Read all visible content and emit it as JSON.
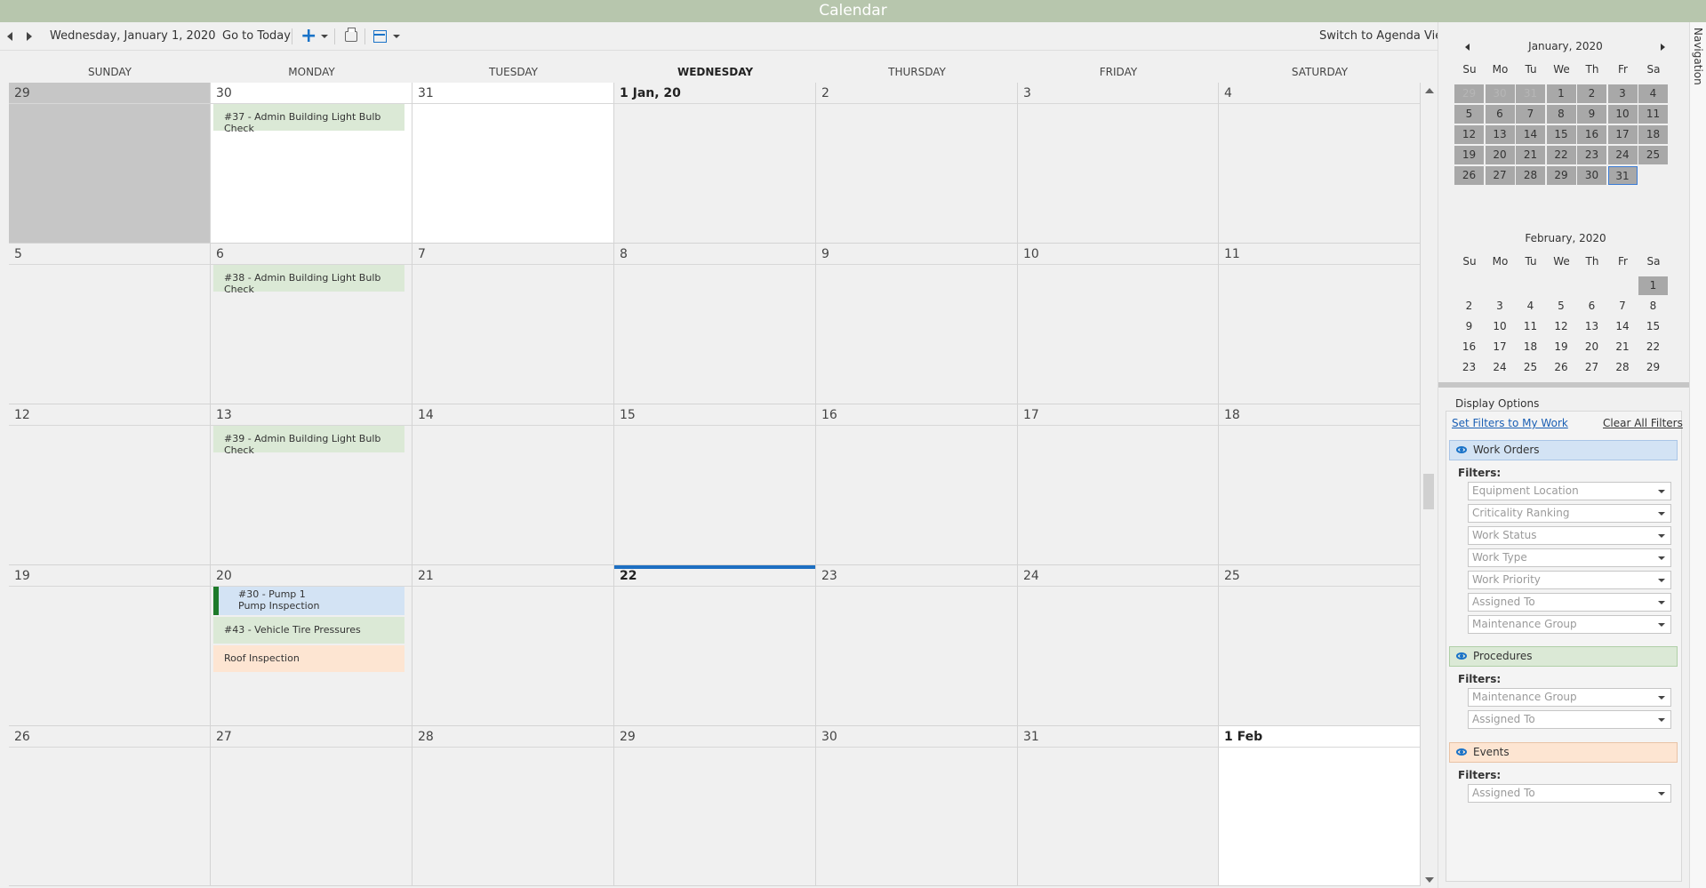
{
  "window": {
    "title": "Calendar"
  },
  "toolbar": {
    "current_date": "Wednesday, January 1, 2020",
    "go_to_today": "Go to Today",
    "switch_view": "Switch to Agenda View"
  },
  "calendar": {
    "day_headers": [
      "SUNDAY",
      "MONDAY",
      "TUESDAY",
      "WEDNESDAY",
      "THURSDAY",
      "FRIDAY",
      "SATURDAY"
    ],
    "today_header_index": 3,
    "weeks": [
      [
        {
          "label": "29",
          "style": "grey"
        },
        {
          "label": "30",
          "style": "white",
          "events": [
            {
              "type": "wo",
              "text": "#37 - Admin Building Light Bulb Check"
            }
          ]
        },
        {
          "label": "31",
          "style": "white"
        },
        {
          "label": "1 Jan, 20",
          "bold": true
        },
        {
          "label": "2"
        },
        {
          "label": "3"
        },
        {
          "label": "4"
        }
      ],
      [
        {
          "label": "5"
        },
        {
          "label": "6",
          "events": [
            {
              "type": "wo",
              "text": "#38 - Admin Building Light Bulb Check"
            }
          ]
        },
        {
          "label": "7"
        },
        {
          "label": "8"
        },
        {
          "label": "9"
        },
        {
          "label": "10"
        },
        {
          "label": "11"
        }
      ],
      [
        {
          "label": "12"
        },
        {
          "label": "13",
          "events": [
            {
              "type": "wo",
              "text": "#39 - Admin Building Light Bulb Check"
            }
          ]
        },
        {
          "label": "14"
        },
        {
          "label": "15"
        },
        {
          "label": "16"
        },
        {
          "label": "17"
        },
        {
          "label": "18"
        }
      ],
      [
        {
          "label": "19"
        },
        {
          "label": "20",
          "events": [
            {
              "type": "wo-blue",
              "text": "#30 - Pump 1",
              "text2": "Pump Inspection"
            },
            {
              "type": "wo",
              "text": "#43 - Vehicle Tire Pressures"
            },
            {
              "type": "ev",
              "text": "Roof Inspection"
            }
          ]
        },
        {
          "label": "21"
        },
        {
          "label": "22",
          "bold": true,
          "today": true
        },
        {
          "label": "23"
        },
        {
          "label": "24"
        },
        {
          "label": "25"
        }
      ],
      [
        {
          "label": "26"
        },
        {
          "label": "27"
        },
        {
          "label": "28"
        },
        {
          "label": "29"
        },
        {
          "label": "30"
        },
        {
          "label": "31"
        },
        {
          "label": "1 Feb",
          "bold": true,
          "style": "white"
        }
      ]
    ]
  },
  "mini_calendars": [
    {
      "title": "January, 2020",
      "dow": [
        "Su",
        "Mo",
        "Tu",
        "We",
        "Th",
        "Fr",
        "Sa"
      ],
      "weeks": [
        [
          {
            "d": "29",
            "dim": true,
            "hl": true
          },
          {
            "d": "30",
            "dim": true,
            "hl": true
          },
          {
            "d": "31",
            "dim": true,
            "hl": true
          },
          {
            "d": "1",
            "hl": true
          },
          {
            "d": "2",
            "hl": true
          },
          {
            "d": "3",
            "hl": true
          },
          {
            "d": "4",
            "hl": true
          }
        ],
        [
          {
            "d": "5",
            "hl": true
          },
          {
            "d": "6",
            "hl": true
          },
          {
            "d": "7",
            "hl": true
          },
          {
            "d": "8",
            "hl": true
          },
          {
            "d": "9",
            "hl": true
          },
          {
            "d": "10",
            "hl": true
          },
          {
            "d": "11",
            "hl": true
          }
        ],
        [
          {
            "d": "12",
            "hl": true
          },
          {
            "d": "13",
            "hl": true
          },
          {
            "d": "14",
            "hl": true
          },
          {
            "d": "15",
            "hl": true
          },
          {
            "d": "16",
            "hl": true
          },
          {
            "d": "17",
            "hl": true
          },
          {
            "d": "18",
            "hl": true
          }
        ],
        [
          {
            "d": "19",
            "hl": true
          },
          {
            "d": "20",
            "hl": true
          },
          {
            "d": "21",
            "hl": true
          },
          {
            "d": "22",
            "hl": true
          },
          {
            "d": "23",
            "hl": true
          },
          {
            "d": "24",
            "hl": true
          },
          {
            "d": "25",
            "hl": true
          }
        ],
        [
          {
            "d": "26",
            "hl": true
          },
          {
            "d": "27",
            "hl": true
          },
          {
            "d": "28",
            "hl": true
          },
          {
            "d": "29",
            "hl": true
          },
          {
            "d": "30",
            "hl": true
          },
          {
            "d": "31",
            "hl": true,
            "sel": true
          },
          {
            "d": ""
          }
        ]
      ]
    },
    {
      "title": "February, 2020",
      "dow": [
        "Su",
        "Mo",
        "Tu",
        "We",
        "Th",
        "Fr",
        "Sa"
      ],
      "weeks": [
        [
          {
            "d": ""
          },
          {
            "d": ""
          },
          {
            "d": ""
          },
          {
            "d": ""
          },
          {
            "d": ""
          },
          {
            "d": ""
          },
          {
            "d": "1",
            "hl": true
          }
        ],
        [
          {
            "d": "2"
          },
          {
            "d": "3"
          },
          {
            "d": "4"
          },
          {
            "d": "5"
          },
          {
            "d": "6"
          },
          {
            "d": "7"
          },
          {
            "d": "8"
          }
        ],
        [
          {
            "d": "9"
          },
          {
            "d": "10"
          },
          {
            "d": "11"
          },
          {
            "d": "12"
          },
          {
            "d": "13"
          },
          {
            "d": "14"
          },
          {
            "d": "15"
          }
        ],
        [
          {
            "d": "16"
          },
          {
            "d": "17"
          },
          {
            "d": "18"
          },
          {
            "d": "19"
          },
          {
            "d": "20"
          },
          {
            "d": "21"
          },
          {
            "d": "22"
          }
        ],
        [
          {
            "d": "23"
          },
          {
            "d": "24"
          },
          {
            "d": "25"
          },
          {
            "d": "26"
          },
          {
            "d": "27"
          },
          {
            "d": "28"
          },
          {
            "d": "29"
          }
        ]
      ]
    }
  ],
  "display_options": {
    "title": "Display Options",
    "set_filters_link": "Set Filters to My Work",
    "clear_filters_link": "Clear All Filters",
    "filters_label": "Filters:",
    "sections": [
      {
        "name": "Work Orders",
        "style": "wo",
        "filters": [
          "Equipment Location",
          "Criticality Ranking",
          "Work Status",
          "Work Type",
          "Work Priority",
          "Assigned To",
          "Maintenance Group"
        ]
      },
      {
        "name": "Procedures",
        "style": "pr",
        "filters": [
          "Maintenance Group",
          "Assigned To"
        ]
      },
      {
        "name": "Events",
        "style": "ev",
        "filters": [
          "Assigned To"
        ]
      }
    ]
  },
  "navigation_tab": "Navigation"
}
